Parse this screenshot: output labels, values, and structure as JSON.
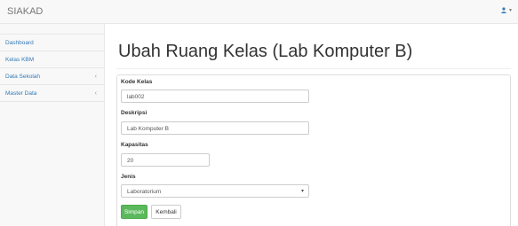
{
  "navbar": {
    "brand": "SIAKAD",
    "user_icon": "user-icon"
  },
  "sidebar": {
    "items": [
      {
        "label": "Dashboard"
      },
      {
        "label": "Kelas KBM"
      },
      {
        "label": "Data Sekolah",
        "arrow": "‹"
      },
      {
        "label": "Master Data",
        "arrow": "‹"
      }
    ]
  },
  "main": {
    "title": "Ubah Ruang Kelas (Lab Komputer B)",
    "form": {
      "kode_label": "Kode Kelas",
      "kode_value": "lab002",
      "deskripsi_label": "Deskripsi",
      "deskripsi_value": "Lab Komputer B",
      "kapasitas_label": "Kapasitas",
      "kapasitas_value": "20",
      "jenis_label": "Jenis",
      "jenis_value": "Laboratorium",
      "save_label": "Simpan",
      "back_label": "Kembali"
    }
  },
  "colors": {
    "accent": "#337ab7",
    "success": "#5cb85c"
  }
}
